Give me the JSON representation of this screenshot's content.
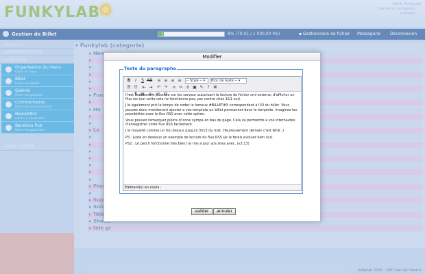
{
  "app": {
    "logo": "FUNKYLAB",
    "logo_version": "3",
    "header_info": [
      "Mark: Funkyzal",
      "Dernière connexion: ...",
      "Compte: ..."
    ]
  },
  "menubar": {
    "title": "Gestion de Billet",
    "progress_percent": 8,
    "progress_text": "8% (70,05 / 1 000,00 Mo)",
    "items": [
      "Gestionnaire de fichier",
      "Messagerie",
      "Déconnexion"
    ]
  },
  "sidebar": {
    "head1": "ACCUEIL",
    "head2": "ADMINISTRATION",
    "head3": "CONTENU",
    "items": [
      {
        "label": "Organisation du menu",
        "sub": "Gérer le menu"
      },
      {
        "label": "Billet",
        "sub": "Gérer les billets"
      },
      {
        "label": "Galerie",
        "sub": "Gérer les galeries"
      },
      {
        "label": "Commentaires",
        "sub": "Gérer les commentaires"
      },
      {
        "label": "Newsletter",
        "sub": "Gérer la newsletter"
      },
      {
        "label": "Bandeau Pub",
        "sub": "Gérer les publicités"
      }
    ],
    "account": "MON COMPTE"
  },
  "main": {
    "category": "Funkylab (categorie)",
    "rows": [
      "News",
      "",
      "",
      "",
      "",
      "",
      "Fun",
      "",
      "Hu",
      "",
      "",
      "Le",
      "",
      "",
      "",
      "",
      "",
      "",
      "",
      "Produ",
      "",
      "Supp",
      "Solut",
      "Téléc",
      "Shows",
      "tele gr"
    ]
  },
  "modal": {
    "title": "Modifier",
    "legend": "Texte du paragraphe",
    "style_select": "-- Style --",
    "block_select": "Bloc de texte --",
    "paragraphs": [
      "Il est maintenant possible sur les serveur autorisant la lecture de fichier xml externe, d'afficher un flux rss (sur ovito cela ne fonctionne pas, par contre chez 1&1 oui).",
      "J'ai également pris le temps de coder le fameux #BILLET#X correspondant à l'ID du billet. Vous pouvez donc maintenant ajouter a vos template un billet permanent dans le template. Imaginez les possibilités avec le flux RSS avec cette option.",
      "Vous pouvez remarquer pleins d'icone sympa en bas de page. Cela va permettre a vos internautes d'enregistrer votre flux RSS facilement.",
      "J'ai travaillé comme un fou dessus jusqu'a 3h15 du mat. Heureusement demain c'est férié :)",
      "PS : juste en dessous un exemple de lecture du flux RSS (je le ferais evoluer bien sur)",
      "PS2 : Le patch fonctionne tres bien j'ai mis a jour vos sites avec. (v2.13)"
    ],
    "status": "Elément(s) en cours :",
    "validate": "valider",
    "cancel": "annuler"
  },
  "footer": "funkylab 2003 - 2007 par Ozil Pansiri"
}
